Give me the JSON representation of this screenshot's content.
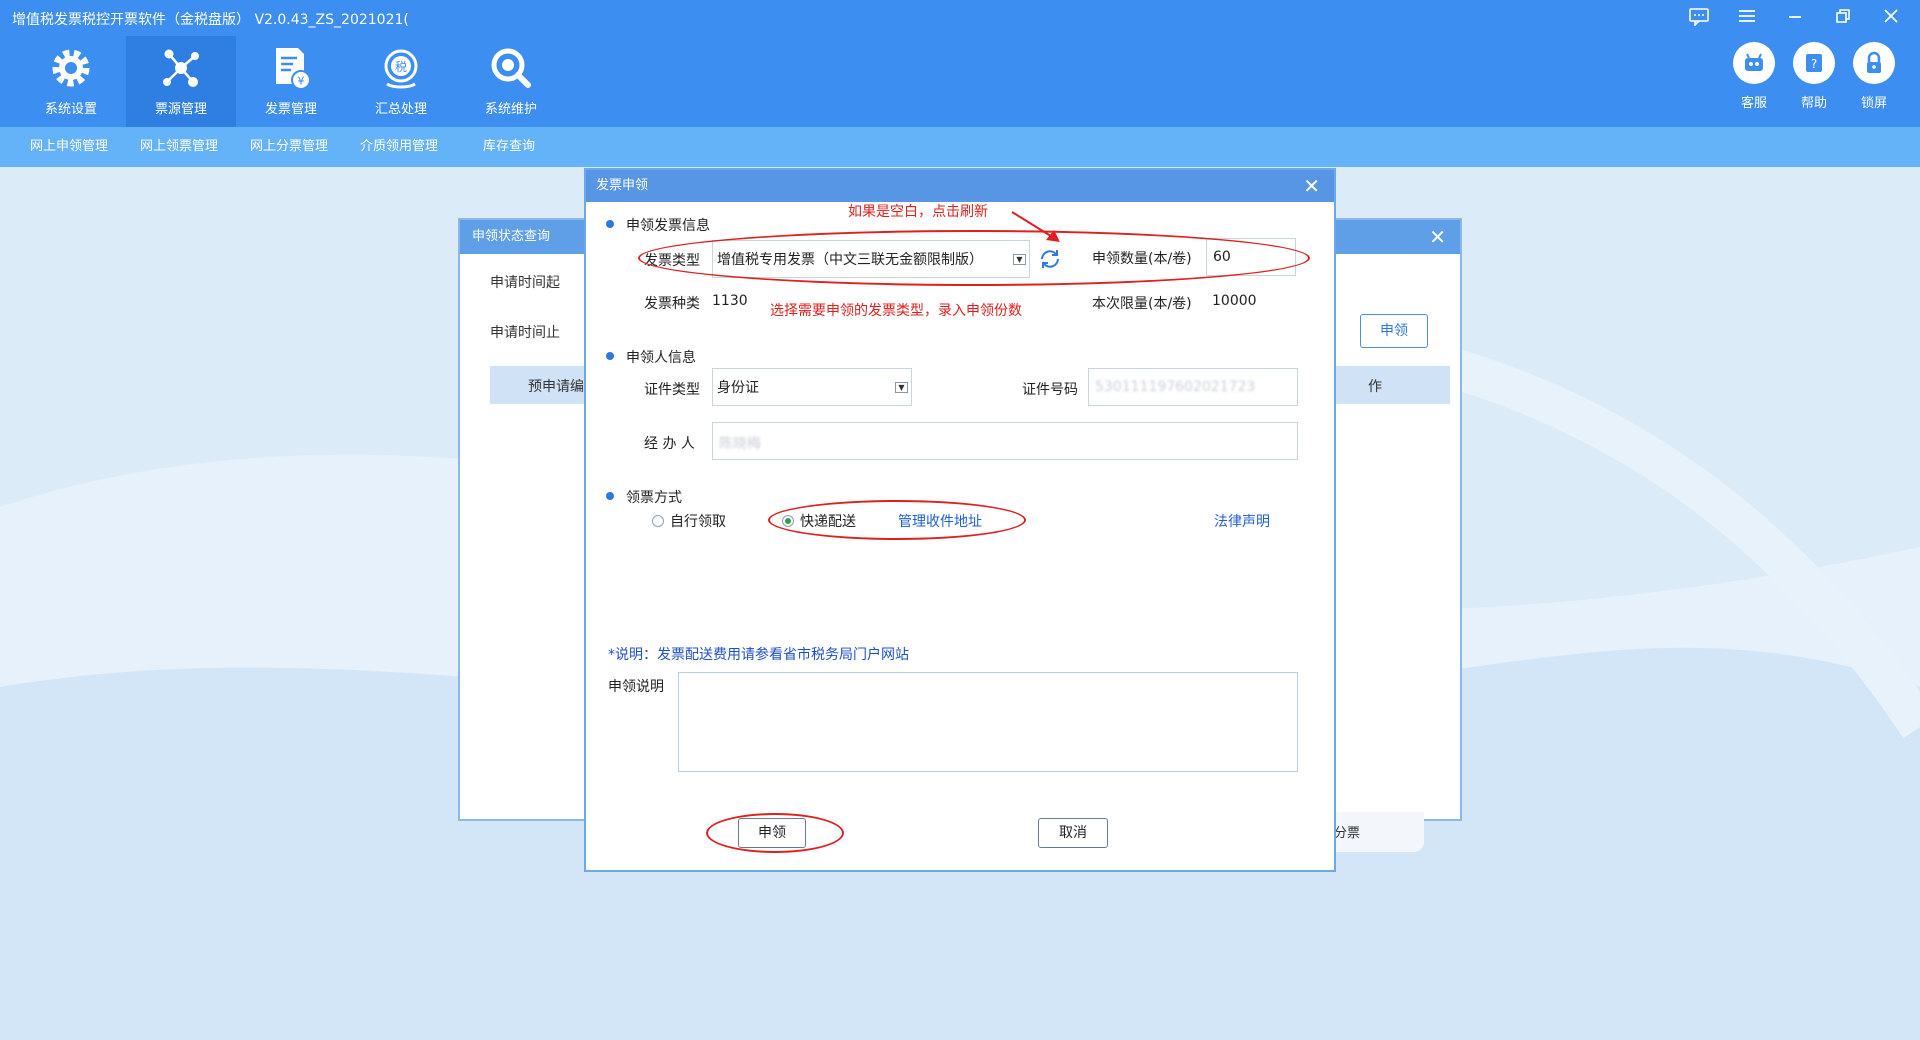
{
  "window": {
    "title": "增值税发票税控开票软件（金税盘版） V2.0.43_ZS_2021021(",
    "controls": [
      "message-icon",
      "menu-icon",
      "minimize-icon",
      "restore-icon",
      "close-icon"
    ]
  },
  "modules": [
    {
      "label": "系统设置",
      "icon": "gear-icon",
      "active": false
    },
    {
      "label": "票源管理",
      "icon": "network-icon",
      "active": true
    },
    {
      "label": "发票管理",
      "icon": "invoice-icon",
      "active": false
    },
    {
      "label": "汇总处理",
      "icon": "tax-summary-icon",
      "active": false
    },
    {
      "label": "系统维护",
      "icon": "maintenance-icon",
      "active": false
    }
  ],
  "right_tools": [
    {
      "label": "客服",
      "icon": "robot-icon"
    },
    {
      "label": "帮助",
      "icon": "help-icon"
    },
    {
      "label": "锁屏",
      "icon": "lock-icon"
    }
  ],
  "subnav": [
    "网上申领管理",
    "网上领票管理",
    "网上分票管理",
    "介质领用管理",
    "库存查询"
  ],
  "back_dialog": {
    "title": "申领状态查询",
    "start_label": "申请时间起",
    "end_label": "申请时间止",
    "apply_button": "申领",
    "table_head_left": "预申请编",
    "table_head_right": "作",
    "tail_text": "分票"
  },
  "dialog": {
    "title": "发票申领",
    "section_invoice": "申领发票信息",
    "invoice_type_label": "发票类型",
    "invoice_type_value": "增值税专用发票（中文三联无金额限制版）",
    "quantity_label": "申领数量(本/卷)",
    "quantity_value": "60",
    "kind_label": "发票种类",
    "kind_value": "1130",
    "limit_label": "本次限量(本/卷)",
    "limit_value": "10000",
    "annotation_refresh": "如果是空白，点击刷新",
    "annotation_select": "选择需要申领的发票类型，录入申领份数",
    "section_applicant": "申领人信息",
    "id_type_label": "证件类型",
    "id_type_value": "身份证",
    "id_number_label": "证件号码",
    "id_number_value": "530111197602021723",
    "handler_label": "经 办 人",
    "handler_value": "陈晓梅",
    "section_method": "领票方式",
    "method_self": "自行领取",
    "method_express": "快递配送",
    "manage_address_link": "管理收件地址",
    "legal_link": "法律声明",
    "note": "*说明：发票配送费用请参看省市税务局门户网站",
    "remark_label": "申领说明",
    "remark_value": "",
    "apply_button": "申领",
    "cancel_button": "取消"
  },
  "colors": {
    "header_blue": "#3c8ef0",
    "active_module": "#2f7ee2",
    "subnav": "#64b2f8",
    "annotation_red": "#e02020",
    "link_blue": "#1f5fd4"
  }
}
